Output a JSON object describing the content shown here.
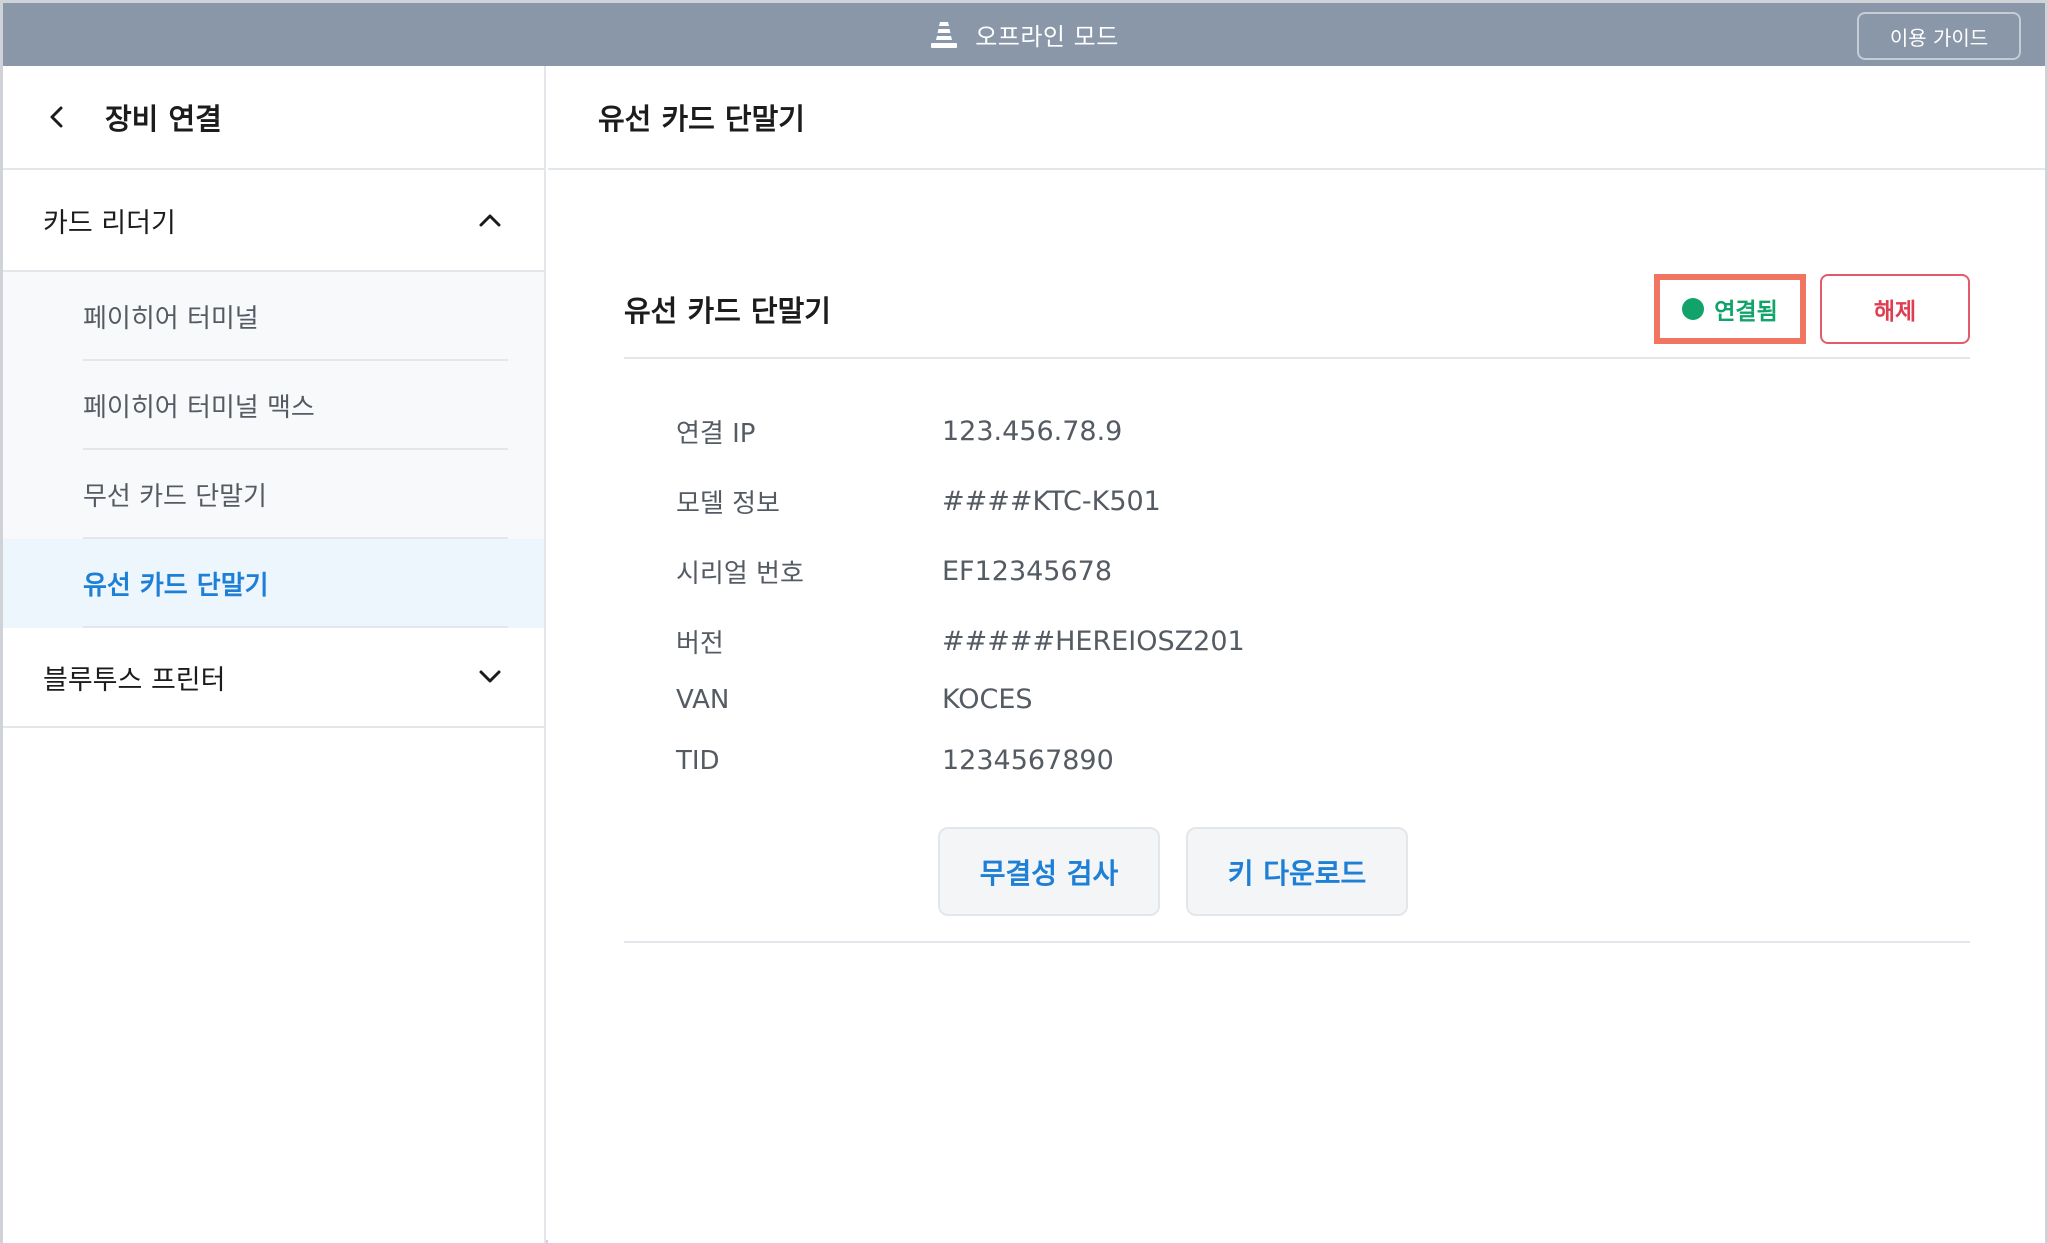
{
  "topbar": {
    "title": "오프라인 모드",
    "icon": "traffic-cone-icon",
    "guide_label": "이용 가이드"
  },
  "sidebar": {
    "title": "장비 연결",
    "groups": [
      {
        "label": "카드 리더기",
        "expanded": true,
        "items": [
          {
            "label": "페이히어 터미널"
          },
          {
            "label": "페이히어 터미널 맥스"
          },
          {
            "label": "무선 카드 단말기"
          },
          {
            "label": "유선 카드 단말기",
            "active": true
          }
        ]
      },
      {
        "label": "블루투스 프린터",
        "expanded": false
      }
    ]
  },
  "main": {
    "title": "유선 카드 단말기",
    "card": {
      "title": "유선 카드 단말기",
      "status_label": "연결됨",
      "disconnect_label": "해제",
      "info": [
        {
          "label": "연결 IP",
          "value": "123.456.78.9"
        },
        {
          "label": "모델 정보",
          "value": "####KTC-K501"
        },
        {
          "label": "시리얼 번호",
          "value": "EF12345678"
        },
        {
          "label": "버전",
          "value": "#####HEREIOSZ201"
        },
        {
          "label": "VAN",
          "value": "KOCES"
        },
        {
          "label": "TID",
          "value": "1234567890"
        }
      ],
      "integrity_label": "무결성 검사",
      "key_download_label": "키 다운로드"
    }
  },
  "colors": {
    "topbar": "#8a97a8",
    "accent_blue": "#1e7fd6",
    "status_green": "#12a36b",
    "danger_red": "#df3d52",
    "highlight": "#f27561"
  }
}
